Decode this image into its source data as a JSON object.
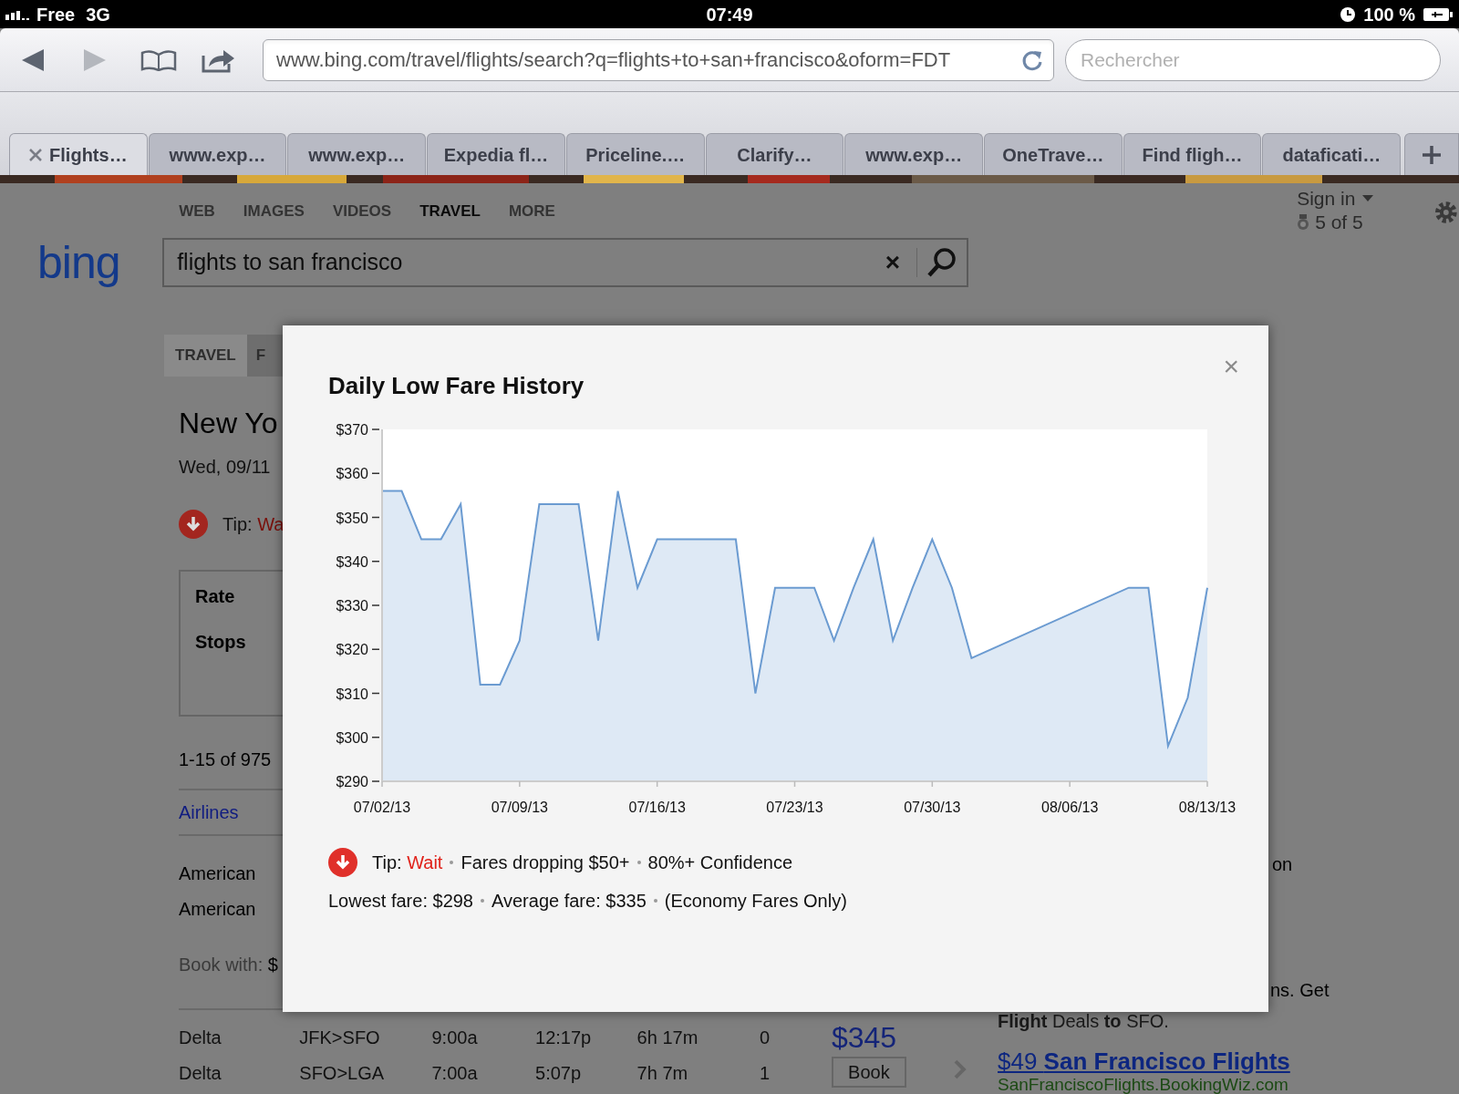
{
  "status_bar": {
    "carrier": "Free",
    "network": "3G",
    "time": "07:49",
    "battery": "100 %"
  },
  "toolbar": {
    "nav_buttons": [
      {
        "kind": "back",
        "disabled": false
      },
      {
        "kind": "forward",
        "disabled": true
      }
    ],
    "url": "www.bing.com/travel/flights/search?q=flights+to+san+francisco&oform=FDT",
    "search_placeholder": "Rechercher"
  },
  "tabs": [
    {
      "label": "Flights…",
      "selected": true
    },
    {
      "label": "www.exp…",
      "selected": false
    },
    {
      "label": "www.exp…",
      "selected": false
    },
    {
      "label": "Expedia fl…",
      "selected": false
    },
    {
      "label": "Priceline.…",
      "selected": false
    },
    {
      "label": "Clarify…",
      "selected": false
    },
    {
      "label": "www.exp…",
      "selected": false
    },
    {
      "label": "OneTrave…",
      "selected": false
    },
    {
      "label": "Find fligh…",
      "selected": false
    },
    {
      "label": "dataficati…",
      "selected": false
    }
  ],
  "page": {
    "logo": "bing",
    "nav": [
      {
        "label": "WEB",
        "selected": false
      },
      {
        "label": "IMAGES",
        "selected": false
      },
      {
        "label": "VIDEOS",
        "selected": false
      },
      {
        "label": "TRAVEL",
        "selected": true
      },
      {
        "label": "MORE",
        "selected": false
      }
    ],
    "query": "flights to san francisco",
    "clear": "×",
    "sign_in": "Sign in",
    "rewards": "5 of 5",
    "section_tabs": [
      {
        "label": "TRAVEL",
        "selected": false
      },
      {
        "label": "F",
        "selected": true
      }
    ],
    "heading": "New Yo",
    "date": "Wed, 09/11",
    "tip": {
      "label": "Tip:",
      "action": "Wa"
    },
    "filters": [
      "Rate",
      "Stops"
    ],
    "count": "1-15 of 975",
    "airlines_header": "Airlines",
    "airlines": [
      "American",
      "American"
    ],
    "book_with": {
      "label": "Book with:",
      "value": "$"
    },
    "flights": [
      {
        "airline": "Delta",
        "route": "JFK>SFO",
        "depart": "9:00a",
        "arrive": "12:17p",
        "duration": "6h 17m",
        "stops": "0"
      },
      {
        "airline": "Delta",
        "route": "SFO>LGA",
        "depart": "7:00a",
        "arrive": "5:07p",
        "duration": "7h 7m",
        "stops": "1"
      }
    ],
    "price": "$345",
    "book": "Book",
    "side": {
      "fragments": [
        "on",
        "ns. Get"
      ],
      "promo": "**Flight** Deals **to** SFO.",
      "ad_title": "$49 **San Francisco Flights**",
      "ad_url": "SanFranciscoFlights.BookingWiz.com"
    }
  },
  "modal": {
    "close": "×",
    "chart_data": {
      "type": "area",
      "title": "Daily Low Fare History",
      "categories": [
        "07/02/13",
        null,
        null,
        null,
        null,
        null,
        null,
        "07/09/13",
        null,
        null,
        null,
        null,
        null,
        null,
        "07/16/13",
        null,
        null,
        null,
        null,
        null,
        null,
        "07/23/13",
        null,
        null,
        null,
        null,
        null,
        null,
        "07/30/13",
        null,
        null,
        null,
        null,
        null,
        null,
        "08/06/13",
        null,
        null,
        null,
        null,
        null,
        null,
        "08/13/13"
      ],
      "series": [
        {
          "color": "#6b9bd1",
          "values": [
            356,
            356,
            345,
            345,
            353,
            312,
            312,
            322,
            353,
            null,
            353,
            322,
            356,
            334,
            345,
            null,
            null,
            null,
            345,
            310,
            334,
            null,
            334,
            322,
            334,
            345,
            322,
            334,
            345,
            334,
            318,
            null,
            null,
            null,
            null,
            null,
            null,
            null,
            334,
            334,
            298,
            309,
            334
          ]
        }
      ],
      "ylim": [
        290,
        370
      ],
      "yticks": [
        {
          "value": 290,
          "label": "$290"
        },
        {
          "value": 300,
          "label": "$300"
        },
        {
          "value": 310,
          "label": "$310"
        },
        {
          "value": 320,
          "label": "$320"
        },
        {
          "value": 330,
          "label": "$330"
        },
        {
          "value": 340,
          "label": "$340"
        },
        {
          "value": 350,
          "label": "$350"
        },
        {
          "value": 360,
          "label": "$360"
        },
        {
          "value": 370,
          "label": "$370"
        }
      ]
    },
    "tip": {
      "label": "Tip:",
      "action": "Wait",
      "details": [
        "Fares dropping $50+",
        "80%+ Confidence"
      ]
    },
    "summary": [
      "Lowest fare: $298",
      "Average fare: $335",
      "(Economy Fares Only)"
    ]
  }
}
